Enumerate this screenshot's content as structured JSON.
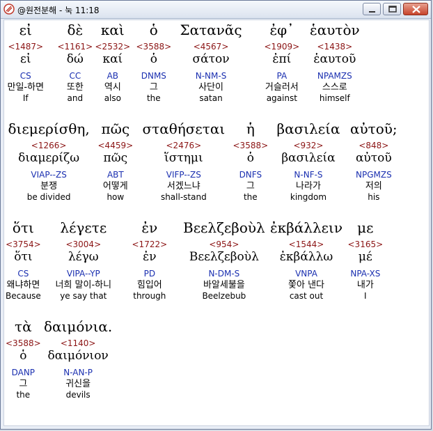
{
  "window": {
    "title": "@원전분해 - 눅 11:18"
  },
  "rows": [
    [
      {
        "greek": "εἰ",
        "strong": "<1487>",
        "lemma": "εἰ",
        "parse": "CS",
        "korean": "만일-하면",
        "english": "If"
      },
      {
        "greek": "δὲ",
        "strong": "<1161>",
        "lemma": "δώ",
        "parse": "CC",
        "korean": "또한",
        "english": "and"
      },
      {
        "greek": "καὶ",
        "strong": "<2532>",
        "lemma": "καί",
        "parse": "AB",
        "korean": "역시",
        "english": "also"
      },
      {
        "greek": "ὁ",
        "strong": "<3588>",
        "lemma": "ὁ",
        "parse": "DNMS",
        "korean": "그",
        "english": "the"
      },
      {
        "greek": "Σατανᾶς",
        "strong": "<4567>",
        "lemma": "σάτον",
        "parse": "N-NM-S",
        "korean": "사단이",
        "english": "satan"
      },
      {
        "greek": "ἐφ᾽",
        "strong": "<1909>",
        "lemma": "ἐπί",
        "parse": "PA",
        "korean": "거슬러서",
        "english": "against"
      },
      {
        "greek": "ἑαυτὸν",
        "strong": "<1438>",
        "lemma": "ἑαυτοῦ",
        "parse": "NPAMZS",
        "korean": "스스로",
        "english": "himself"
      }
    ],
    [
      {
        "greek": "διεμερίσθη,",
        "strong": "<1266>",
        "lemma": "διαμερίζω",
        "parse": "VIAP--ZS",
        "korean": "분쟁",
        "english": "be divided"
      },
      {
        "greek": "πῶς",
        "strong": "<4459>",
        "lemma": "πῶς",
        "parse": "ABT",
        "korean": "어떻게",
        "english": "how"
      },
      {
        "greek": "σταθήσεται",
        "strong": "<2476>",
        "lemma": "ἵστημι",
        "parse": "VIFP--ZS",
        "korean": "서겠느냐",
        "english": "shall-stand"
      },
      {
        "greek": "ἡ",
        "strong": "<3588>",
        "lemma": "ὁ",
        "parse": "DNFS",
        "korean": "그",
        "english": "the"
      },
      {
        "greek": "βασιλεία",
        "strong": "<932>",
        "lemma": "βασιλεία",
        "parse": "N-NF-S",
        "korean": "나라가",
        "english": "kingdom"
      },
      {
        "greek": "αὐτοῦ;",
        "strong": "<848>",
        "lemma": "αὐτοῦ",
        "parse": "NPGMZS",
        "korean": "저의",
        "english": "his"
      }
    ],
    [
      {
        "greek": "ὅτι",
        "strong": "<3754>",
        "lemma": "ὅτι",
        "parse": "CS",
        "korean": "왜냐하면",
        "english": "Because"
      },
      {
        "greek": "λέγετε",
        "strong": "<3004>",
        "lemma": "λέγω",
        "parse": "VIPA--YP",
        "korean": "너희 말이-하니",
        "english": "ye say that"
      },
      {
        "greek": "ἐν",
        "strong": "<1722>",
        "lemma": "ἐν",
        "parse": "PD",
        "korean": "힘입어",
        "english": "through"
      },
      {
        "greek": "Βεελζεβοὺλ",
        "strong": "<954>",
        "lemma": "Βεελζεβοὺλ",
        "parse": "N-DM-S",
        "korean": "바알세불을",
        "english": "Beelzebub"
      },
      {
        "greek": "ἐκβάλλειν",
        "strong": "<1544>",
        "lemma": "ἐκβάλλω",
        "parse": "VNPA",
        "korean": "쫓아 낸다",
        "english": "cast out"
      },
      {
        "greek": "με",
        "strong": "<3165>",
        "lemma": "μέ",
        "parse": "NPA-XS",
        "korean": "내가",
        "english": "I"
      }
    ],
    [
      {
        "greek": "τὰ",
        "strong": "<3588>",
        "lemma": "ὁ",
        "parse": "DANP",
        "korean": "그",
        "english": "the"
      },
      {
        "greek": "δαιμόνια.",
        "strong": "<1140>",
        "lemma": "δαιμόνιον",
        "parse": "N-AN-P",
        "korean": "귀신을",
        "english": "devils"
      }
    ]
  ],
  "colors": {
    "strong": "#8b1414",
    "parse": "#1a2fb0",
    "background": "#ffffff"
  }
}
